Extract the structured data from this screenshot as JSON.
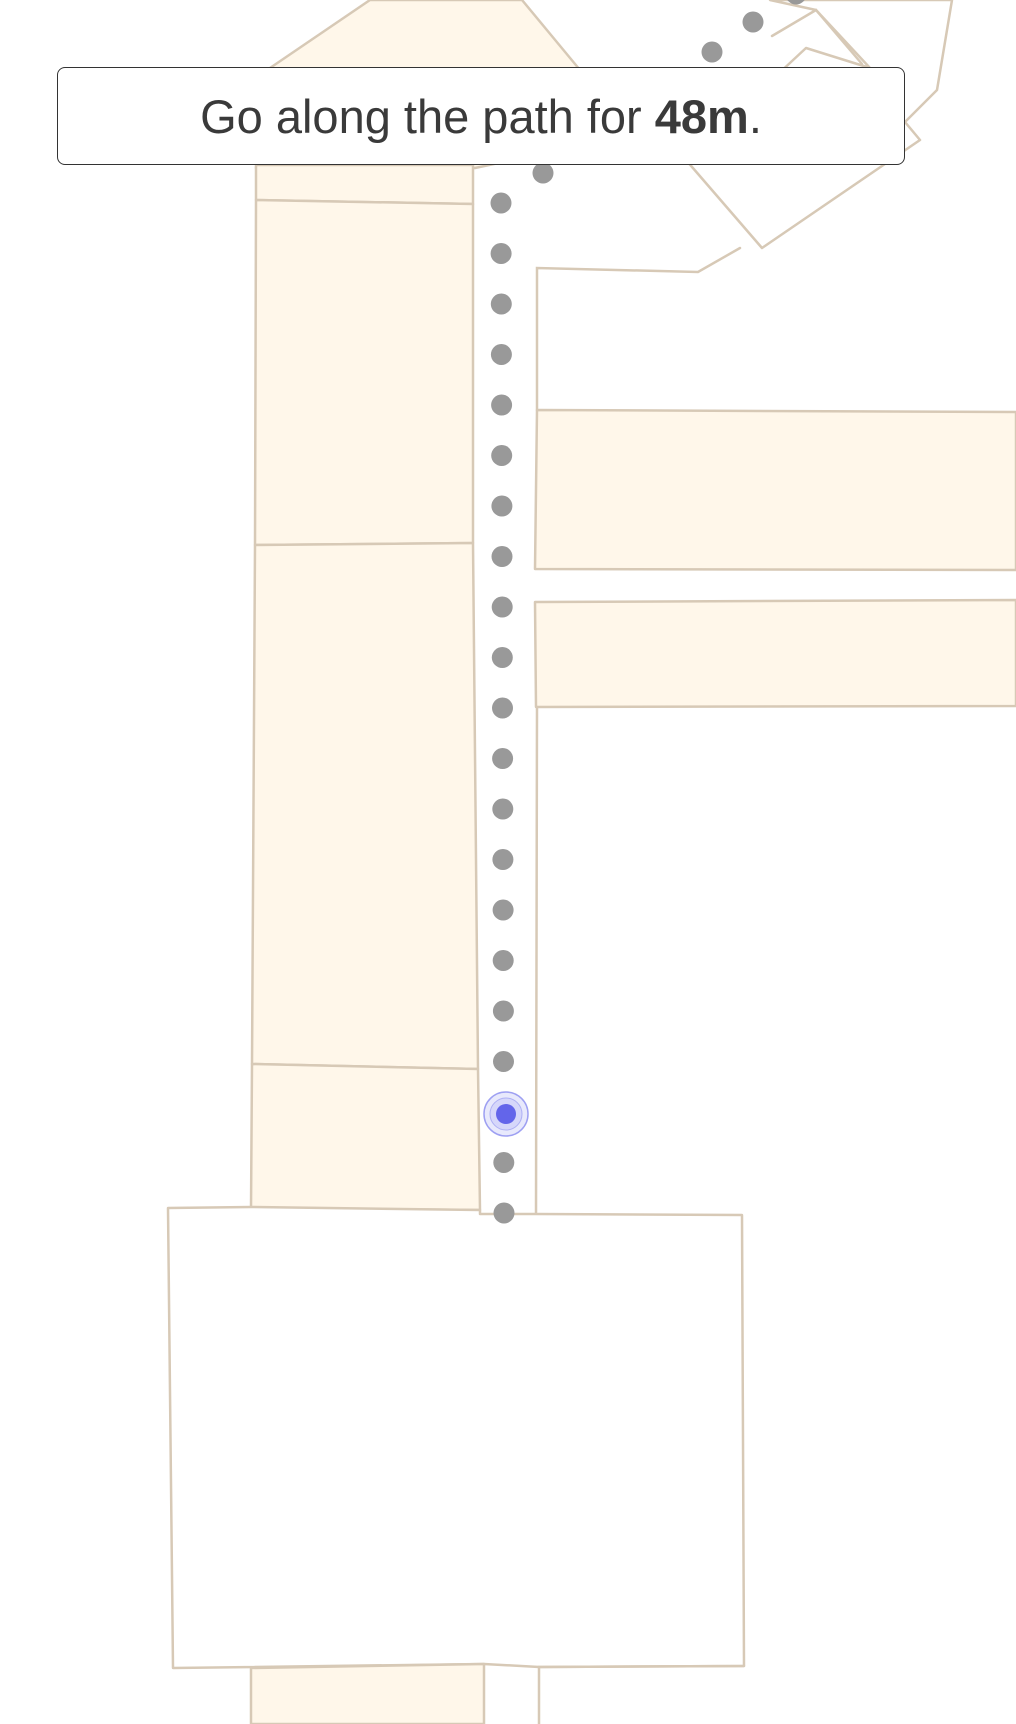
{
  "instruction": {
    "prefix": "Go along the path for ",
    "distance": "48m",
    "suffix": "."
  },
  "route": {
    "dot_color": "#999999",
    "current_location_color": "#6365ea"
  },
  "map": {
    "room_fill_color": "#fff7ea",
    "wall_color": "#d7c9b6",
    "background_color": "#ffffff"
  }
}
